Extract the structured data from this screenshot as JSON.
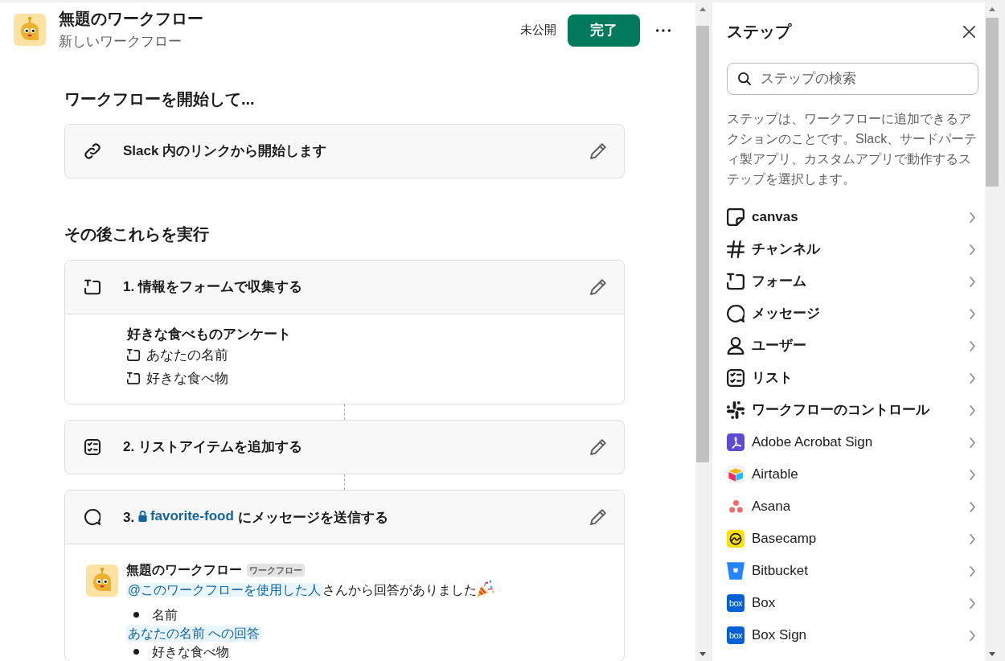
{
  "header": {
    "title": "無題のワークフロー",
    "subtitle": "新しいワークフロー",
    "status": "未公開",
    "done_button": "完了"
  },
  "trigger": {
    "heading": "ワークフローを開始して...",
    "label": "Slack 内のリンクから開始します"
  },
  "steps_heading": "その後これらを実行",
  "steps": [
    {
      "kind": "form",
      "title": "1. 情報をフォームで収集する",
      "form_title": "好きな食べものアンケート",
      "fields": [
        "あなたの名前",
        "好きな食べ物"
      ]
    },
    {
      "kind": "list",
      "title": "2. リストアイテムを追加する"
    },
    {
      "kind": "message",
      "number": "3.",
      "channel": "favorite-food",
      "action": "にメッセージを送信する",
      "message": {
        "sender": "無題のワークフロー",
        "badge": "ワークフロー",
        "mention": "@このワークフローを使用した人",
        "text": "さんから回答がありました",
        "lines": [
          {
            "kind": "bullet",
            "text": "名前"
          },
          {
            "kind": "variable",
            "text": "あなたの名前 への回答"
          },
          {
            "kind": "bullet",
            "text": "好きな食べ物"
          }
        ]
      }
    }
  ],
  "steps_panel": {
    "title": "ステップ",
    "search": {
      "placeholder": "ステップの検索"
    },
    "description": "ステップは、ワークフローに追加できるアクションのことです。Slack、サードパーティ製アプリ、カスタムアプリで動作するステップを選択します。",
    "items": [
      {
        "kind": "builtin",
        "label": "canvas"
      },
      {
        "kind": "builtin",
        "label": "チャンネル"
      },
      {
        "kind": "builtin",
        "label": "フォーム"
      },
      {
        "kind": "builtin",
        "label": "メッセージ"
      },
      {
        "kind": "builtin",
        "label": "ユーザー"
      },
      {
        "kind": "builtin",
        "label": "リスト"
      },
      {
        "kind": "builtin",
        "label": "ワークフローのコントロール"
      },
      {
        "kind": "app",
        "label": "Adobe Acrobat Sign"
      },
      {
        "kind": "app",
        "label": "Airtable"
      },
      {
        "kind": "app",
        "label": "Asana"
      },
      {
        "kind": "app",
        "label": "Basecamp"
      },
      {
        "kind": "app",
        "label": "Bitbucket"
      },
      {
        "kind": "app",
        "label": "Box",
        "logo_text": "box"
      },
      {
        "kind": "app",
        "label": "Box Sign",
        "logo_text": "box"
      }
    ]
  }
}
